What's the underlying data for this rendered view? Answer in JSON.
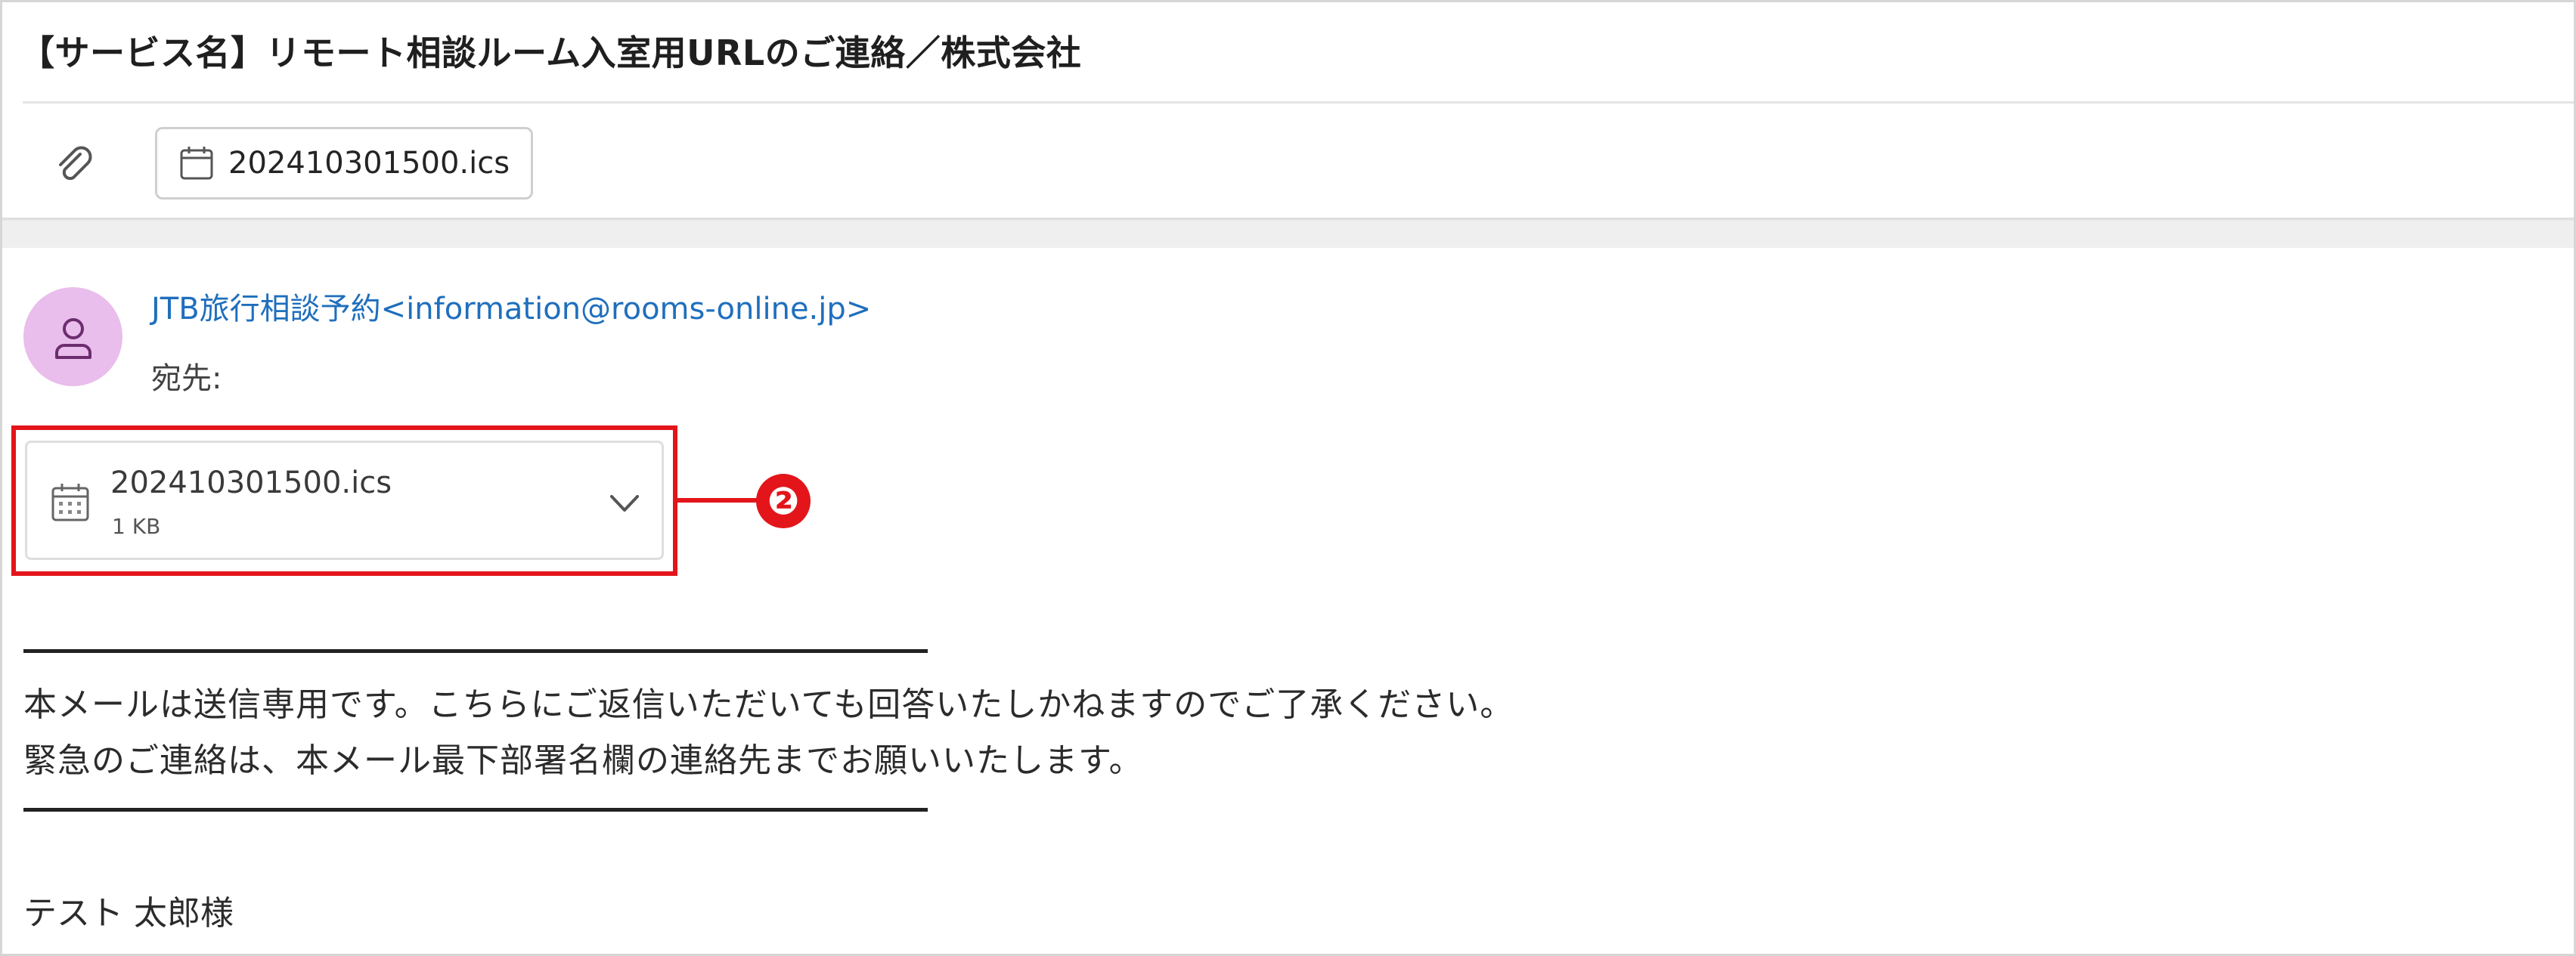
{
  "email": {
    "subject": "【サービス名】リモート相談ルーム入室用URLのご連絡／株式会社",
    "header_attachment": {
      "label": "202410301500.ics",
      "icon": "calendar-icon"
    },
    "sender": "JTB旅行相談予約<information@rooms-online.jp>",
    "to_label": "宛先:",
    "attachment": {
      "name": "202410301500.ics",
      "size": "1 KB",
      "icon": "calendar-icon",
      "expand_icon": "chevron-down-icon"
    },
    "callout_number": "❷",
    "body": {
      "line1": "本メールは送信専用です。こちらにご返信いただいても回答いたしかねますのでご了承ください。",
      "line2": "緊急のご連絡は、本メール最下部署名欄の連絡先までお願いいたします。",
      "greeting": "テスト 太郎様"
    }
  },
  "colors": {
    "sender_link": "#1f6fbd",
    "avatar_bg": "#e9bdec",
    "highlight_red": "#e3151a"
  }
}
